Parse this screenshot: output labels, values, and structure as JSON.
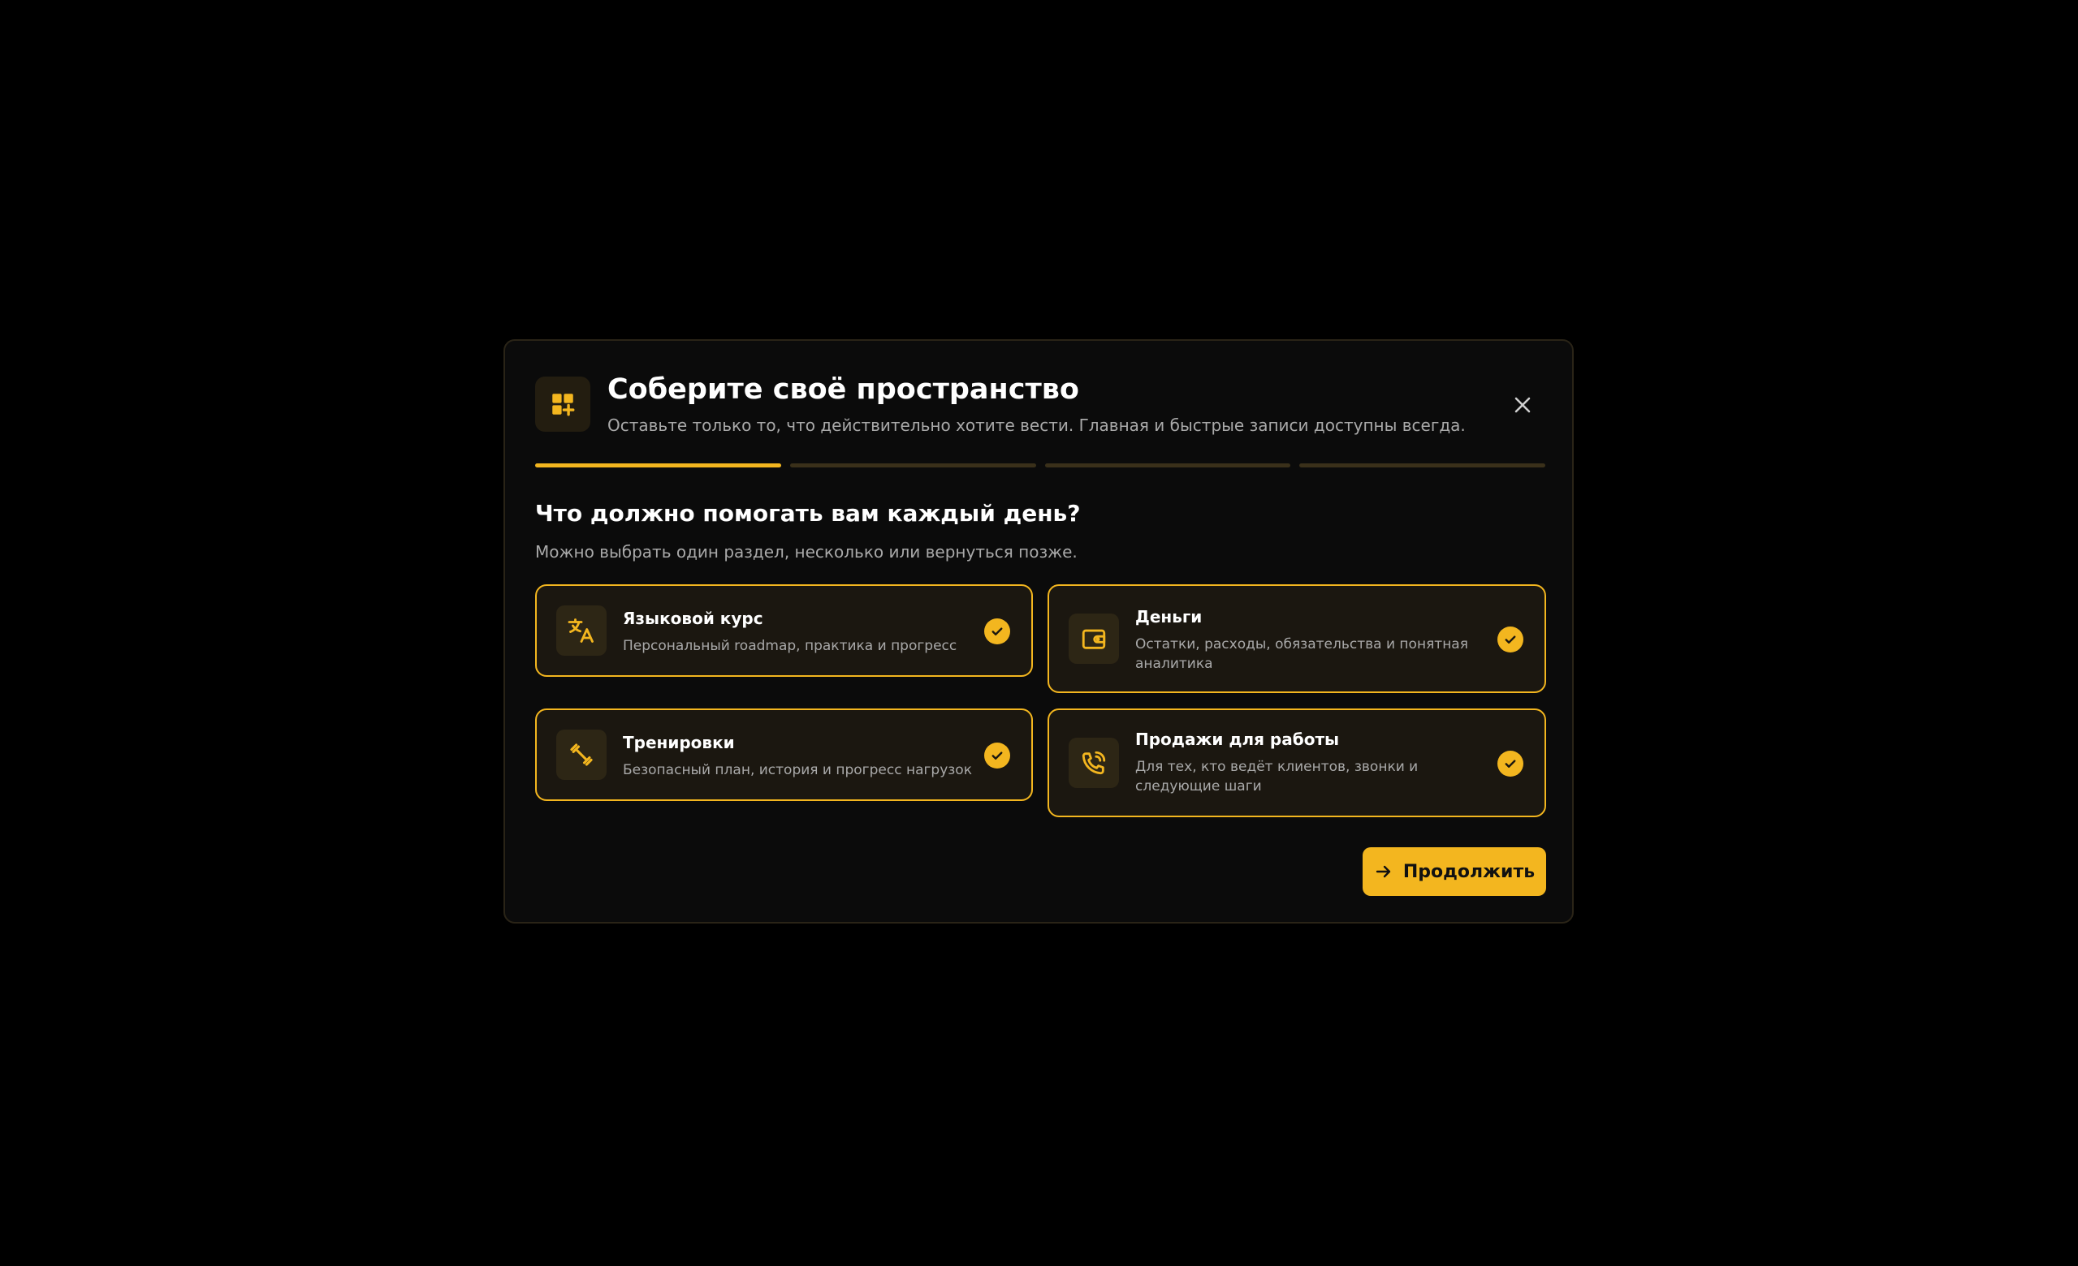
{
  "modal": {
    "title": "Соберите своё пространство",
    "subtitle": "Оставьте только то, что действительно хотите вести. Главная и быстрые записи доступны всегда.",
    "header_icon": "dashboard-add-icon",
    "close_icon": "close-icon"
  },
  "progress": {
    "total_steps": 4,
    "current_step": 1
  },
  "question": {
    "title": "Что должно помогать вам каждый день?",
    "subtitle": "Можно выбрать один раздел, несколько или вернуться позже."
  },
  "options": [
    {
      "title": "Языковой курс",
      "description": "Персональный roadmap, практика и прогресс",
      "icon": "translate-icon",
      "selected": true
    },
    {
      "title": "Деньги",
      "description": "Остатки, расходы, обязательства и понятная аналитика",
      "icon": "wallet-icon",
      "selected": true
    },
    {
      "title": "Тренировки",
      "description": "Безопасный план, история и прогресс нагрузок",
      "icon": "dumbbell-icon",
      "selected": true
    },
    {
      "title": "Продажи для работы",
      "description": "Для тех, кто ведёт клиентов, звонки и следующие шаги",
      "icon": "phone-call-icon",
      "selected": true
    }
  ],
  "continue_button": {
    "label": "Продолжить",
    "icon": "arrow-right-icon"
  },
  "colors": {
    "accent": "#f3b61f",
    "background": "#000000",
    "modal_background": "#0b0b0b",
    "card_background": "#1b1710",
    "muted_text": "#a9a9a9"
  }
}
